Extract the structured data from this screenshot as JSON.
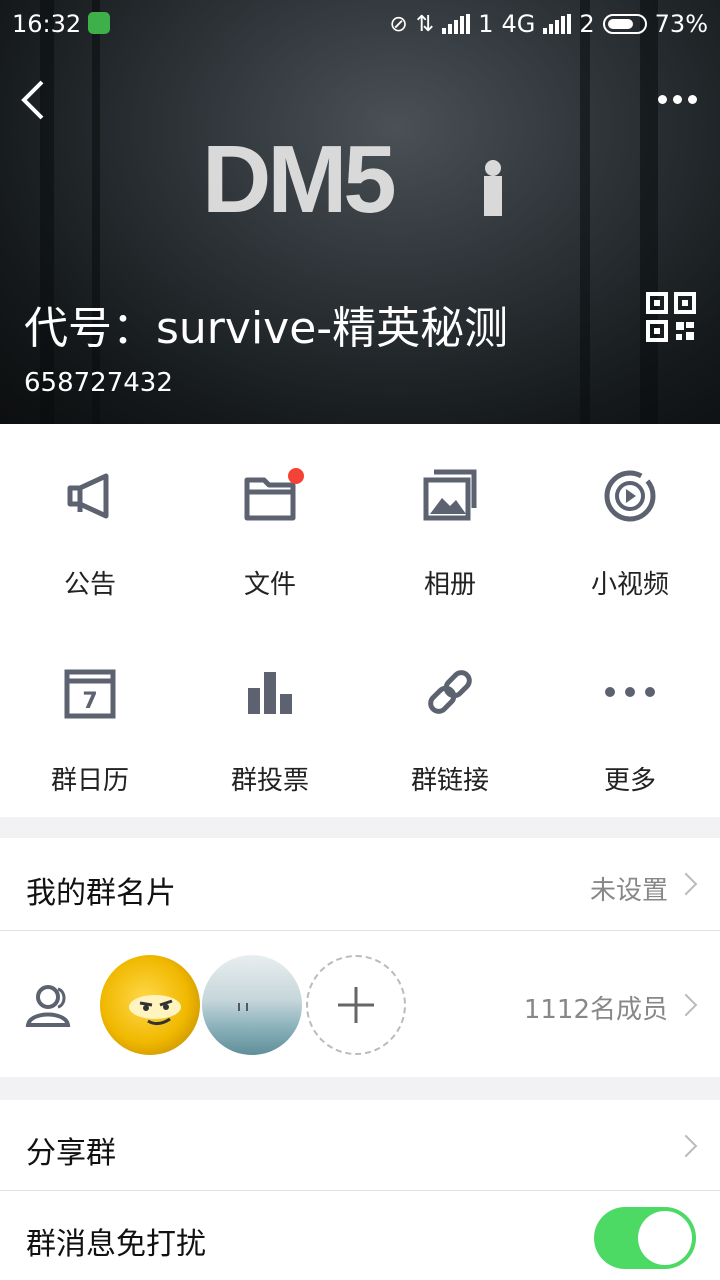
{
  "status_bar": {
    "time": "16:32",
    "sim1": "1",
    "network": "4G",
    "sim2": "2",
    "battery_percent": "73%",
    "battery_level": 0.73
  },
  "header": {
    "logo_text": "DM5",
    "group_name": "代号：survive-精英秘测",
    "group_id": "658727432",
    "icons": {
      "back": "back-arrow-icon",
      "more": "more-dots-icon",
      "qr": "qr-code-icon"
    }
  },
  "features": [
    {
      "label": "公告",
      "icon": "announcement-icon"
    },
    {
      "label": "文件",
      "icon": "folder-icon",
      "badge": true
    },
    {
      "label": "相册",
      "icon": "album-icon"
    },
    {
      "label": "小视频",
      "icon": "video-icon"
    },
    {
      "label": "群日历",
      "icon": "calendar-icon",
      "calendar_day": "7"
    },
    {
      "label": "群投票",
      "icon": "vote-chart-icon"
    },
    {
      "label": "群链接",
      "icon": "link-icon"
    },
    {
      "label": "更多",
      "icon": "more-icon"
    }
  ],
  "my_card": {
    "label": "我的群名片",
    "value": "未设置"
  },
  "members": {
    "count_text": "1112名成员",
    "icon": "members-icon"
  },
  "share": {
    "label": "分享群"
  },
  "dnd": {
    "label": "群消息免打扰",
    "enabled": true
  },
  "colors": {
    "accent_green": "#4cd964",
    "badge_red": "#f44336",
    "icon_gray": "#5d6270"
  }
}
